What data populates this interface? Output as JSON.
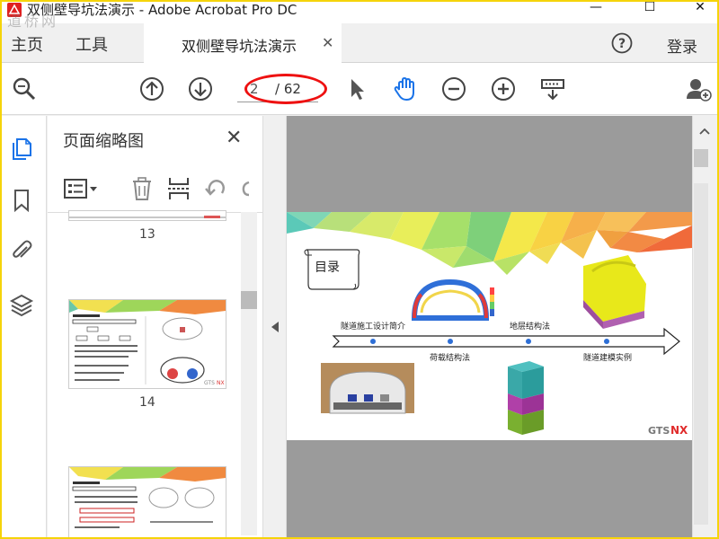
{
  "window": {
    "title": "双侧壁导坑法演示 - Adobe Acrobat Pro DC",
    "watermark": "道桥网",
    "controls": [
      "—",
      "☐",
      "✕"
    ]
  },
  "tabs": {
    "home_label": "主页",
    "tools_label": "工具",
    "document_tab_label": "双侧壁导坑法演示",
    "close_symbol": "✕",
    "login_label": "登录"
  },
  "toolbar": {
    "current_page": "2",
    "total_pages": "/ 62",
    "icons": [
      "search-zoom-icon",
      "page-up-icon",
      "page-down-icon",
      "select-cursor-icon",
      "hand-tool-icon",
      "zoom-out-icon",
      "zoom-in-icon",
      "page-display-icon",
      "share-user-icon"
    ],
    "accent_color": "#1a73e8"
  },
  "nav": {
    "icons": [
      "page-thumbnails-icon",
      "bookmark-icon",
      "attachment-icon",
      "layers-icon"
    ]
  },
  "thumbnails_panel": {
    "title": "页面缩略图",
    "close_symbol": "✕",
    "tools": [
      "thumbnail-options-icon",
      "delete-icon",
      "insert-page-icon",
      "undo-icon",
      "redo-icon"
    ],
    "items": [
      {
        "label": "13"
      },
      {
        "label": "14"
      }
    ]
  },
  "document_page": {
    "toc_title": "目录",
    "timeline_labels_top": [
      "隧道施工设计简介",
      "地层结构法"
    ],
    "timeline_labels_bottom": [
      "荷载结构法",
      "隧道建模实例"
    ],
    "logo_text_gray": "GTS",
    "logo_text_red": "NX"
  }
}
